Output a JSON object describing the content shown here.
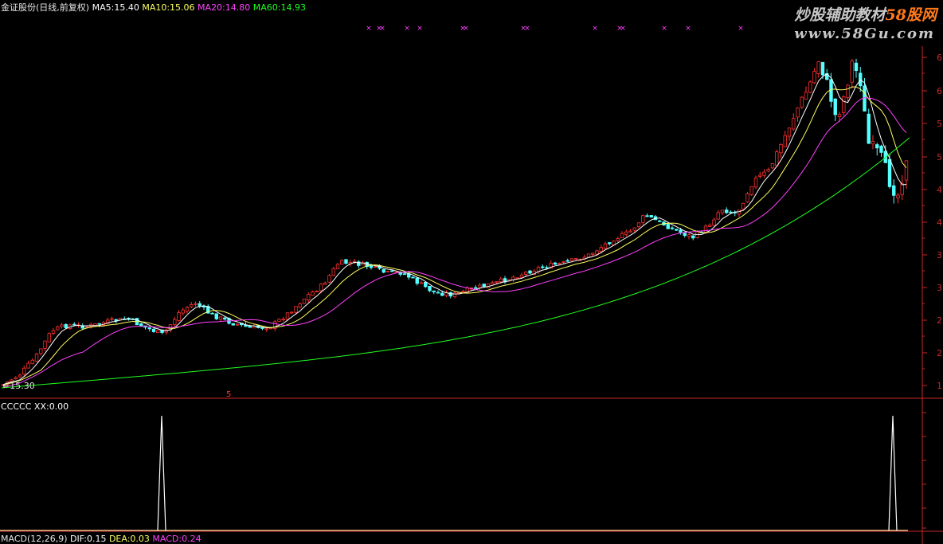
{
  "header": {
    "stock_name": "金证股份",
    "period": "(日线,前复权)",
    "ma5_label": "MA5:",
    "ma5_value": "15.40",
    "ma10_label": "MA10:",
    "ma10_value": "15.06",
    "ma20_label": "MA20:",
    "ma20_value": "14.80",
    "ma60_label": "MA60:",
    "ma60_value": "14.93"
  },
  "watermark": {
    "line1_prefix": "炒股辅助教材",
    "line1_brand": "58股网",
    "line2": "www.58Gu.com"
  },
  "price_panel": {
    "low_marker": "←15.30",
    "signal_marker": "5",
    "y_tick_labels": [
      "6",
      "6",
      "5",
      "5",
      "4",
      "4",
      "3",
      "3",
      "2",
      "2",
      "1"
    ]
  },
  "lower_panel": {
    "title": "CCCCC",
    "xx_label": "XX:",
    "xx_value": "0.00"
  },
  "macd_bar": {
    "title": "MACD(12,26,9)",
    "dif_label": "DIF:",
    "dif_value": "0.15",
    "dea_label": "DEA:",
    "dea_value": "0.03",
    "macd_label": "MACD:",
    "macd_value": "0.24"
  },
  "colors": {
    "background": "#000000",
    "up_candle": "#ff3030",
    "down_candle": "#54ffff",
    "ma5": "#ffffff",
    "ma10": "#ffff60",
    "ma20": "#ff40ff",
    "ma60": "#20ff20",
    "axis": "#c82828",
    "signal_mark": "#ff40ff",
    "indicator_line": "#ffffff",
    "macd_baseline": "#ffe0a0"
  },
  "chart_data": {
    "type": "candlestick",
    "price_range": [
      15.3,
      17.5
    ],
    "signal_marks_count": 17,
    "indicator_spikes": {
      "values": [
        1,
        1
      ],
      "baseline": 0
    },
    "indicator_range": [
      0,
      1
    ]
  }
}
